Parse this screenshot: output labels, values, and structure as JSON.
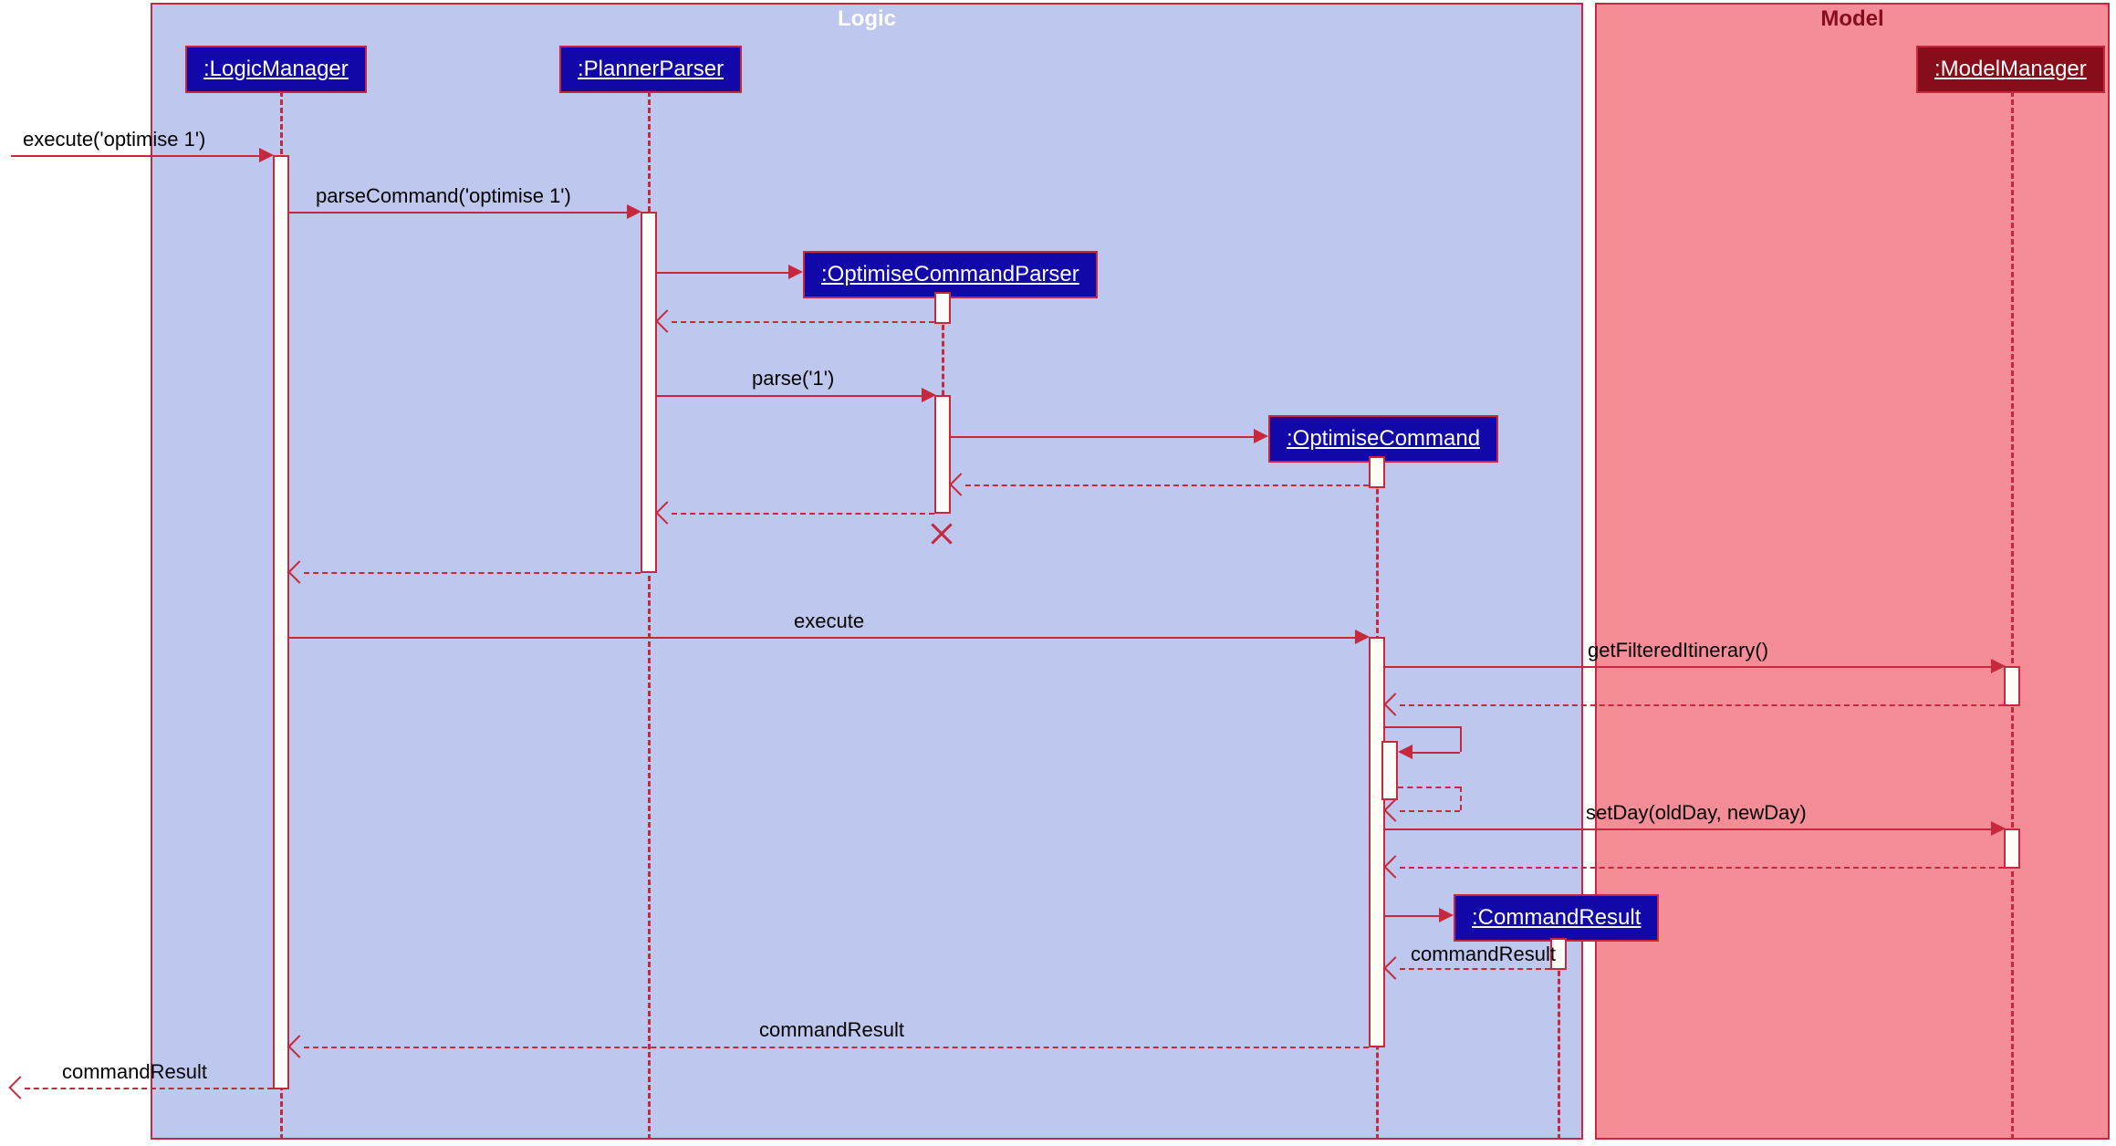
{
  "containers": {
    "logic": {
      "label": "Logic"
    },
    "model": {
      "label": "Model"
    }
  },
  "participants": {
    "logic_manager": ":LogicManager",
    "planner_parser": ":PlannerParser",
    "optimise_command_parser": ":OptimiseCommandParser",
    "optimise_command": ":OptimiseCommand",
    "command_result": ":CommandResult",
    "model_manager": ":ModelManager"
  },
  "messages": {
    "m1_execute_in": "execute('optimise 1')",
    "m2_parse_command": "parseCommand('optimise 1')",
    "m3_parse": "parse('1')",
    "m4_execute": "execute",
    "m5_get_filtered": "getFilteredItinerary()",
    "m6_set_day": "setDay(oldDay, newDay)",
    "m7_command_result_1": "commandResult",
    "m8_command_result_2": "commandResult",
    "m9_command_result_out": "commandResult"
  },
  "chart_data": {
    "type": "sequence-diagram",
    "containers": [
      {
        "name": "Logic",
        "participants": [
          "LogicManager",
          "PlannerParser",
          "OptimiseCommandParser",
          "OptimiseCommand",
          "CommandResult"
        ]
      },
      {
        "name": "Model",
        "participants": [
          "ModelManager"
        ]
      }
    ],
    "participants": [
      {
        "id": "LogicManager",
        "label": ":LogicManager",
        "preexisting": true
      },
      {
        "id": "PlannerParser",
        "label": ":PlannerParser",
        "preexisting": true
      },
      {
        "id": "OptimiseCommandParser",
        "label": ":OptimiseCommandParser",
        "preexisting": false,
        "created_by_step": 3
      },
      {
        "id": "OptimiseCommand",
        "label": ":OptimiseCommand",
        "preexisting": false,
        "created_by_step": 6
      },
      {
        "id": "CommandResult",
        "label": ":CommandResult",
        "preexisting": false,
        "created_by_step": 16
      },
      {
        "id": "ModelManager",
        "label": ":ModelManager",
        "preexisting": true
      }
    ],
    "messages": [
      {
        "step": 1,
        "from": "external",
        "to": "LogicManager",
        "label": "execute('optimise 1')",
        "kind": "sync"
      },
      {
        "step": 2,
        "from": "LogicManager",
        "to": "PlannerParser",
        "label": "parseCommand('optimise 1')",
        "kind": "sync"
      },
      {
        "step": 3,
        "from": "PlannerParser",
        "to": "OptimiseCommandParser",
        "label": "",
        "kind": "create"
      },
      {
        "step": 4,
        "from": "OptimiseCommandParser",
        "to": "PlannerParser",
        "label": "",
        "kind": "return"
      },
      {
        "step": 5,
        "from": "PlannerParser",
        "to": "OptimiseCommandParser",
        "label": "parse('1')",
        "kind": "sync"
      },
      {
        "step": 6,
        "from": "OptimiseCommandParser",
        "to": "OptimiseCommand",
        "label": "",
        "kind": "create"
      },
      {
        "step": 7,
        "from": "OptimiseCommand",
        "to": "OptimiseCommandParser",
        "label": "",
        "kind": "return"
      },
      {
        "step": 8,
        "from": "OptimiseCommandParser",
        "to": "PlannerParser",
        "label": "",
        "kind": "return",
        "destroys": "OptimiseCommandParser"
      },
      {
        "step": 9,
        "from": "PlannerParser",
        "to": "LogicManager",
        "label": "",
        "kind": "return"
      },
      {
        "step": 10,
        "from": "LogicManager",
        "to": "OptimiseCommand",
        "label": "execute",
        "kind": "sync"
      },
      {
        "step": 11,
        "from": "OptimiseCommand",
        "to": "ModelManager",
        "label": "getFilteredItinerary()",
        "kind": "sync"
      },
      {
        "step": 12,
        "from": "ModelManager",
        "to": "OptimiseCommand",
        "label": "",
        "kind": "return"
      },
      {
        "step": 13,
        "from": "OptimiseCommand",
        "to": "OptimiseCommand",
        "label": "",
        "kind": "self-sync"
      },
      {
        "step": 14,
        "from": "OptimiseCommand",
        "to": "ModelManager",
        "label": "setDay(oldDay, newDay)",
        "kind": "sync"
      },
      {
        "step": 15,
        "from": "ModelManager",
        "to": "OptimiseCommand",
        "label": "",
        "kind": "return"
      },
      {
        "step": 16,
        "from": "OptimiseCommand",
        "to": "CommandResult",
        "label": "",
        "kind": "create"
      },
      {
        "step": 17,
        "from": "CommandResult",
        "to": "OptimiseCommand",
        "label": "commandResult",
        "kind": "return"
      },
      {
        "step": 18,
        "from": "OptimiseCommand",
        "to": "LogicManager",
        "label": "commandResult",
        "kind": "return"
      },
      {
        "step": 19,
        "from": "LogicManager",
        "to": "external",
        "label": "commandResult",
        "kind": "return"
      }
    ]
  }
}
